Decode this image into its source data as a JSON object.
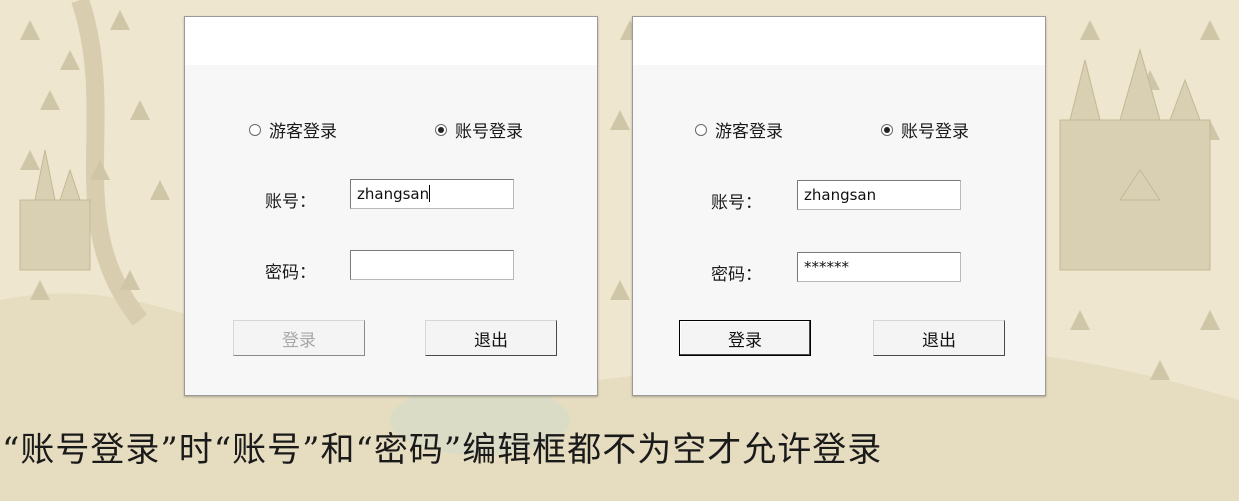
{
  "dialogs": [
    {
      "radio_guest": "游客登录",
      "radio_account": "账号登录",
      "selected_mode": "账号登录",
      "account_label": "账号：",
      "account_value": "zhangsan",
      "password_label": "密码：",
      "password_value": "",
      "login_button": "登录",
      "login_enabled": false,
      "exit_button": "退出"
    },
    {
      "radio_guest": "游客登录",
      "radio_account": "账号登录",
      "selected_mode": "账号登录",
      "account_label": "账号：",
      "account_value": "zhangsan",
      "password_label": "密码：",
      "password_value": "******",
      "login_button": "登录",
      "login_enabled": true,
      "exit_button": "退出"
    }
  ],
  "caption": "“账号登录”时“账号”和“密码”编辑框都不为空才允许登录",
  "colors": {
    "background": "#efe6cf",
    "dialog_bg": "#f7f7f7",
    "disabled_text": "#a8a8a8"
  }
}
